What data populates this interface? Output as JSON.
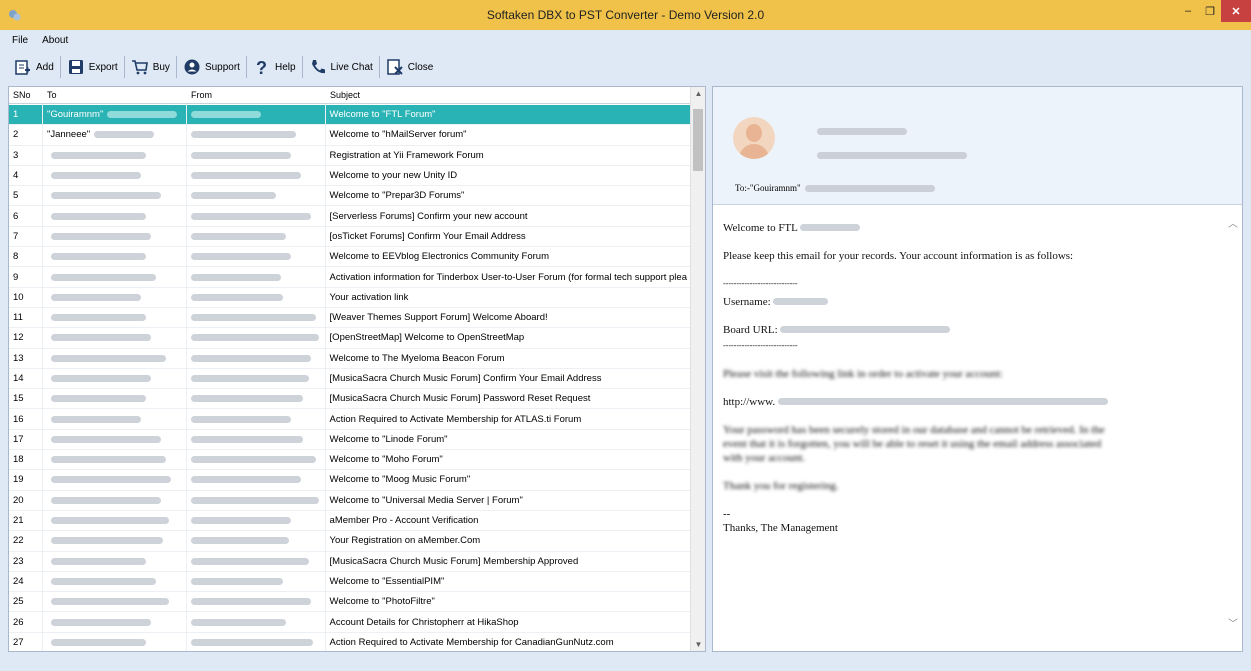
{
  "window": {
    "title": "Softaken DBX to PST Converter - Demo Version 2.0",
    "controls": {
      "minimize": "–",
      "maximize": "❐",
      "close": "✕"
    }
  },
  "menu": {
    "file": "File",
    "about": "About"
  },
  "toolbar": {
    "add": "Add",
    "export": "Export",
    "buy": "Buy",
    "support": "Support",
    "help": "Help",
    "live_chat": "Live Chat",
    "close": "Close"
  },
  "list": {
    "columns": {
      "sno": "SNo",
      "to": "To",
      "from": "From",
      "subject": "Subject"
    },
    "rows": [
      {
        "sno": "1",
        "to": "\"Gouiramnm\"",
        "from": "",
        "subject": "Welcome to \"FTL Forum\""
      },
      {
        "sno": "2",
        "to": "\"Janneee\"",
        "from": "",
        "subject": "Welcome to \"hMailServer forum\""
      },
      {
        "sno": "3",
        "to": "",
        "from": "",
        "subject": "Registration at Yii Framework Forum"
      },
      {
        "sno": "4",
        "to": "",
        "from": "",
        "subject": "Welcome to your new Unity ID"
      },
      {
        "sno": "5",
        "to": "",
        "from": "",
        "subject": "Welcome to \"Prepar3D Forums\""
      },
      {
        "sno": "6",
        "to": "",
        "from": "",
        "subject": "[Serverless Forums] Confirm your new account"
      },
      {
        "sno": "7",
        "to": "",
        "from": "",
        "subject": "[osTicket Forums] Confirm Your Email Address"
      },
      {
        "sno": "8",
        "to": "",
        "from": "",
        "subject": "Welcome to EEVblog Electronics Community Forum"
      },
      {
        "sno": "9",
        "to": "",
        "from": "",
        "subject": "Activation information for Tinderbox User-to-User Forum (for formal tech support plea"
      },
      {
        "sno": "10",
        "to": "",
        "from": "",
        "subject": "Your activation link"
      },
      {
        "sno": "11",
        "to": "",
        "from": "",
        "subject": "[Weaver Themes Support Forum] Welcome Aboard!"
      },
      {
        "sno": "12",
        "to": "",
        "from": "",
        "subject": "[OpenStreetMap] Welcome to OpenStreetMap"
      },
      {
        "sno": "13",
        "to": "",
        "from": "",
        "subject": "Welcome to The Myeloma Beacon Forum"
      },
      {
        "sno": "14",
        "to": "",
        "from": "",
        "subject": "[MusicaSacra Church Music Forum] Confirm Your Email Address"
      },
      {
        "sno": "15",
        "to": "",
        "from": "",
        "subject": "[MusicaSacra Church Music Forum] Password Reset Request"
      },
      {
        "sno": "16",
        "to": "",
        "from": "",
        "subject": "Action Required to Activate Membership for ATLAS.ti Forum"
      },
      {
        "sno": "17",
        "to": "",
        "from": "",
        "subject": "Welcome to \"Linode Forum\""
      },
      {
        "sno": "18",
        "to": "",
        "from": "",
        "subject": "Welcome to \"Moho Forum\""
      },
      {
        "sno": "19",
        "to": "",
        "from": "",
        "subject": "Welcome to \"Moog Music Forum\""
      },
      {
        "sno": "20",
        "to": "",
        "from": "",
        "subject": "Welcome to \"Universal Media Server | Forum\""
      },
      {
        "sno": "21",
        "to": "",
        "from": "",
        "subject": "aMember Pro - Account Verification"
      },
      {
        "sno": "22",
        "to": "",
        "from": "",
        "subject": "Your Registration on aMember.Com"
      },
      {
        "sno": "23",
        "to": "",
        "from": "",
        "subject": "[MusicaSacra Church Music Forum] Membership Approved"
      },
      {
        "sno": "24",
        "to": "",
        "from": "",
        "subject": "Welcome to \"EssentialPIM\""
      },
      {
        "sno": "25",
        "to": "",
        "from": "",
        "subject": "Welcome to \"PhotoFiltre\""
      },
      {
        "sno": "26",
        "to": "",
        "from": "",
        "subject": "Account Details for Christopherr at HikaShop"
      },
      {
        "sno": "27",
        "to": "",
        "from": "",
        "subject": "Action Required to Activate Membership for CanadianGunNutz.com"
      }
    ]
  },
  "preview": {
    "to_label": "To:-\"Gouiramnm\"",
    "body": {
      "greeting": "Welcome to FTL",
      "intro": "Please keep this email for your records. Your account information is as follows:",
      "divider": "----------------------------",
      "username_label": "Username:",
      "board_label": "Board URL:",
      "divider2": "----------------------------",
      "visit": "Please visit the following link in order to activate your account:",
      "link": "http://www.",
      "password_note": "Your password has been securely stored in our database and cannot be retrieved. In the event that it is forgotten, you will be able to reset it using the email address associated with your account.",
      "thanks": "Thank you for registering.",
      "sig_dash": "--",
      "signature": "Thanks, The Management"
    }
  }
}
